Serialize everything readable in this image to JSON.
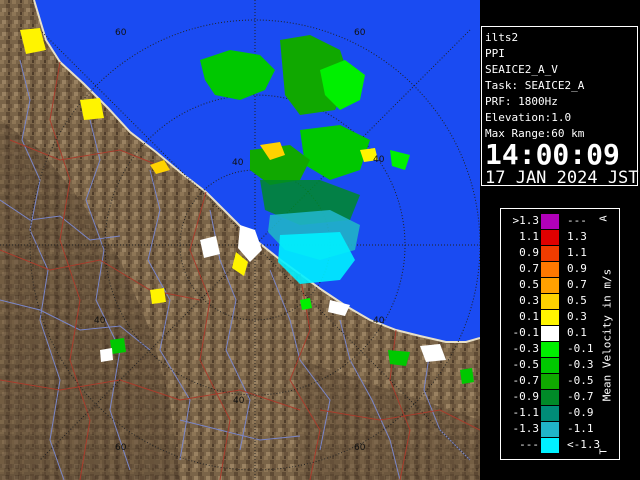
{
  "radar": {
    "range_ring_labels": [
      "60",
      "60",
      "40",
      "40",
      "40",
      "40",
      "40",
      "60",
      "60"
    ],
    "colors": {
      "sea": "#1a4bf2",
      "land": "#7a6448",
      "rivers": "#7a86c8",
      "borders": "#a83c2c",
      "rings": "#222222"
    }
  },
  "info": {
    "site": "ilts2",
    "scan_type": "PPI",
    "product": "SEAICE2_A_V",
    "task": "Task: SEAICE2_A",
    "prf": "PRF: 1800Hz",
    "elevation": "Elevation:1.0",
    "max_range": "Max Range:60 km",
    "time": "14:00:09",
    "date": "17 JAN 2024 JST"
  },
  "legend": {
    "title": "Mean Velocity in m/s",
    "top_marker": "A",
    "bottom_marker": "T",
    "rows": [
      {
        "lo": ">1.3",
        "hi": "---",
        "color": "#b000b8"
      },
      {
        "lo": "1.1",
        "hi": "1.3",
        "color": "#e00000"
      },
      {
        "lo": "0.9",
        "hi": "1.1",
        "color": "#f03c00"
      },
      {
        "lo": "0.7",
        "hi": "0.9",
        "color": "#ff7800"
      },
      {
        "lo": "0.5",
        "hi": "0.7",
        "color": "#ffa000"
      },
      {
        "lo": "0.3",
        "hi": "0.5",
        "color": "#ffd200"
      },
      {
        "lo": "0.1",
        "hi": "0.3",
        "color": "#fff400"
      },
      {
        "lo": "-0.1",
        "hi": "0.1",
        "color": "#ffffff"
      },
      {
        "lo": "-0.3",
        "hi": "-0.1",
        "color": "#00f000"
      },
      {
        "lo": "-0.5",
        "hi": "-0.3",
        "color": "#00c800"
      },
      {
        "lo": "-0.7",
        "hi": "-0.5",
        "color": "#10a800"
      },
      {
        "lo": "-0.9",
        "hi": "-0.7",
        "color": "#008a28"
      },
      {
        "lo": "-1.1",
        "hi": "-0.9",
        "color": "#008c78"
      },
      {
        "lo": "-1.3",
        "hi": "-1.1",
        "color": "#20b4c8"
      },
      {
        "lo": "---",
        "hi": "<-1.3",
        "color": "#00f0ff"
      }
    ]
  }
}
